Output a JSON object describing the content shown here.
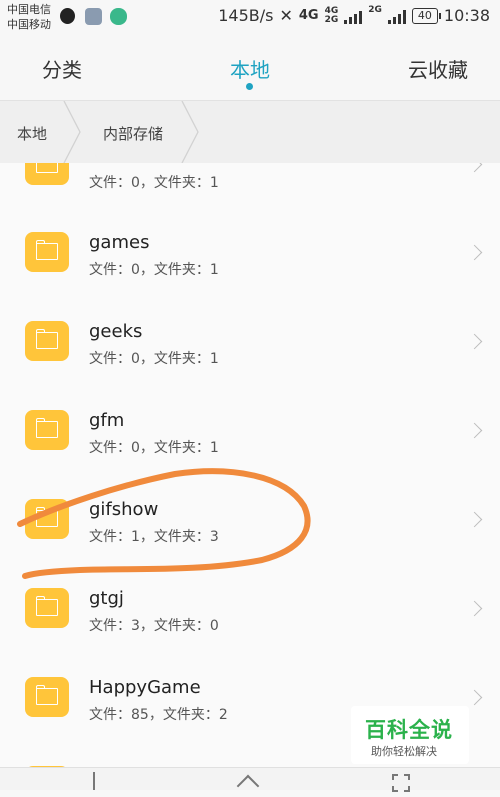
{
  "status_bar": {
    "carrier1": "中国电信",
    "carrier2": "中国移动",
    "speed": "145B/s",
    "net1": "4G",
    "net2a": "4G",
    "net2b": "2G",
    "net3": "2G",
    "battery": "40",
    "time": "10:38"
  },
  "tabs": [
    {
      "label": "分类"
    },
    {
      "label": "本地"
    },
    {
      "label": "云收藏"
    }
  ],
  "breadcrumb": [
    "本地",
    "内部存储"
  ],
  "files": [
    {
      "name": "",
      "meta": "文件：0，文件夹：1"
    },
    {
      "name": "games",
      "meta": "文件：0，文件夹：1"
    },
    {
      "name": "geeks",
      "meta": "文件：0，文件夹：1"
    },
    {
      "name": "gfm",
      "meta": "文件：0，文件夹：1"
    },
    {
      "name": "gifshow",
      "meta": "文件：1，文件夹：3"
    },
    {
      "name": "gtgj",
      "meta": "文件：3，文件夹：0"
    },
    {
      "name": "HappyGame",
      "meta": "文件：85，文件夹：2"
    }
  ],
  "watermark": {
    "title": "百科全说",
    "subtitle": "助你轻松解决"
  },
  "colors": {
    "accent": "#1fa3c2",
    "folder": "#ffc53a",
    "annotation": "#f08a3c"
  }
}
